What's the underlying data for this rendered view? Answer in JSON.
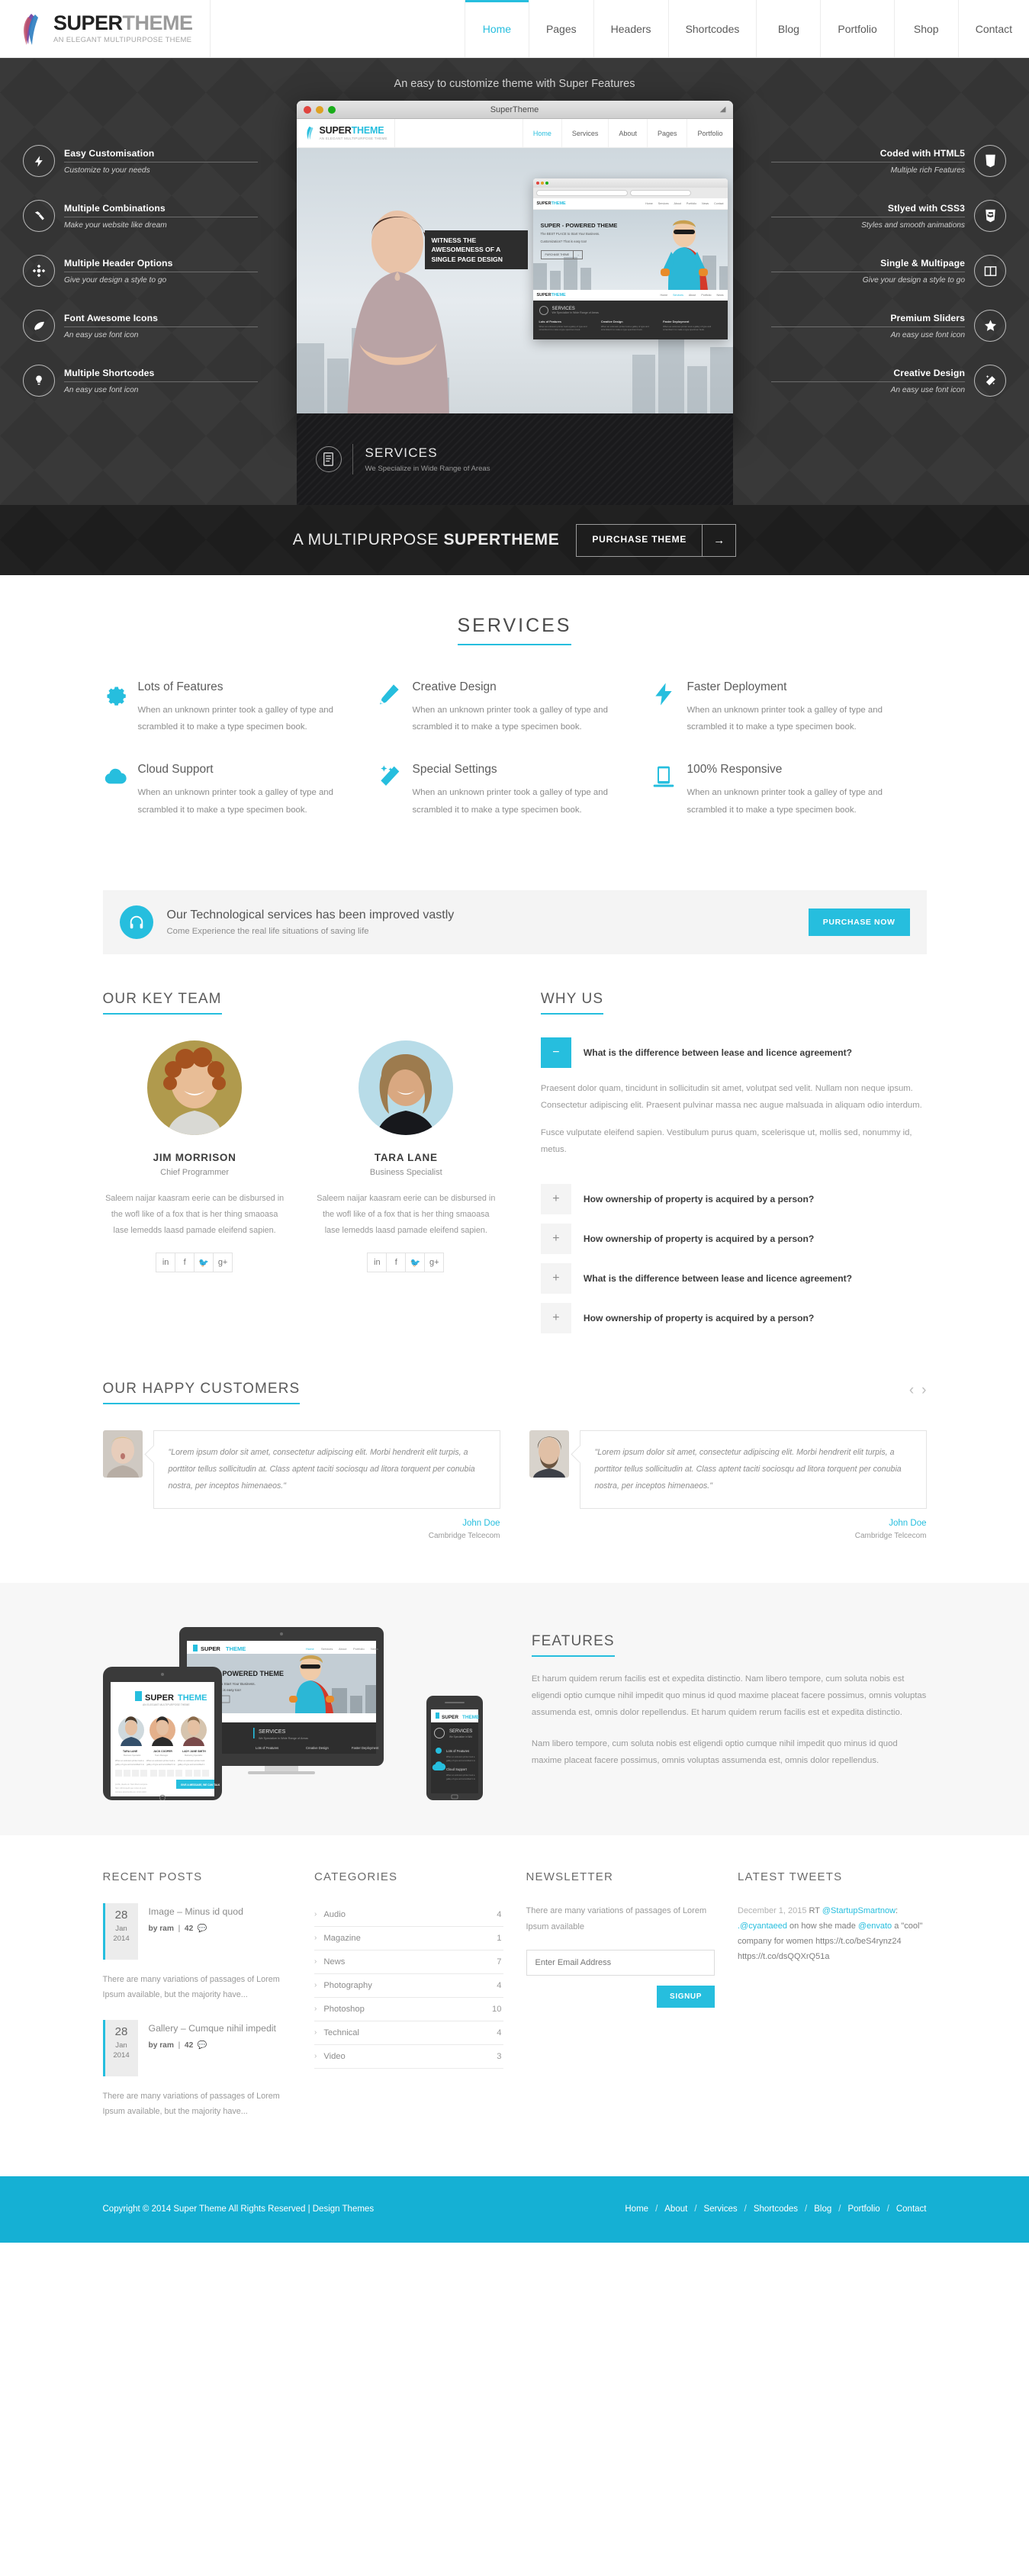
{
  "header": {
    "logo_title_part1": "SUPER",
    "logo_title_part2": "THEME",
    "logo_subtitle": "AN ELEGANT MULTIPURPOSE THEME",
    "nav": [
      {
        "label": "Home",
        "active": true
      },
      {
        "label": "Pages",
        "active": false
      },
      {
        "label": "Headers",
        "active": false
      },
      {
        "label": "Shortcodes",
        "active": false
      },
      {
        "label": "Blog",
        "active": false
      },
      {
        "label": "Portfolio",
        "active": false
      },
      {
        "label": "Shop",
        "active": false
      },
      {
        "label": "Contact",
        "active": false
      }
    ]
  },
  "hero": {
    "tagline": "An easy to customize theme with Super Features",
    "left_features": [
      {
        "title": "Easy Customisation",
        "sub": "Customize to your needs",
        "icon": "bolt-icon"
      },
      {
        "title": "Multiple Combinations",
        "sub": "Make your website like dream",
        "icon": "hammer-icon"
      },
      {
        "title": "Multiple Header Options",
        "sub": "Give your design a style to go",
        "icon": "crosshair-icon"
      },
      {
        "title": "Font Awesome Icons",
        "sub": "An easy use font icon",
        "icon": "leaf-icon"
      },
      {
        "title": "Multiple Shortcodes",
        "sub": "An easy use font icon",
        "icon": "lightbulb-icon"
      }
    ],
    "right_features": [
      {
        "title": "Coded with HTML5",
        "sub": "Multiple rich Features",
        "icon": "html5-icon"
      },
      {
        "title": "Stlyed with CSS3",
        "sub": "Styles and smooth animations",
        "icon": "css3-icon"
      },
      {
        "title": "Single & Multipage",
        "sub": "Give your design a style to go",
        "icon": "columns-icon"
      },
      {
        "title": "Premium Sliders",
        "sub": "An easy use font icon",
        "icon": "star-icon"
      },
      {
        "title": "Creative Design",
        "sub": "An easy use font icon",
        "icon": "magic-wand-icon"
      }
    ],
    "browser": {
      "window_title": "SuperTheme",
      "logo_part1": "SUPER",
      "logo_part2": "THEME",
      "logo_sub": "AN ELEGANT MULTIPURPOSE THEME",
      "nav": [
        "Home",
        "Services",
        "About",
        "Pages",
        "Portfolio"
      ],
      "callout": "WITNESS THE AWESOMENESS OF A SINGLE PAGE DESIGN",
      "inner": {
        "logo_part1": "SUPER",
        "logo_part2": "THEME",
        "nav": [
          "Home",
          "Services",
          "About",
          "Portfolio",
          "News",
          "Contact"
        ],
        "headline": "SUPER - POWERED THEME",
        "sub1": "The BEST PLACE to Start Your Business.",
        "sub2": "Customization? That is easy too!",
        "btn": "PURCHASE THEME",
        "services_title": "SERVICES",
        "services_sub": "We Specialize in Wide Range of Areas",
        "cards": [
          {
            "title": "Lots of Features",
            "text": "When an unknown printer took a galley of type and scrambled it to make a type specimen book."
          },
          {
            "title": "Creative Design",
            "text": "When an unknown printer took a galley of type and scrambled it to make a type specimen book."
          },
          {
            "title": "Faster Deployment",
            "text": "When an unknown printer took a galley of type and scrambled it to make a type specimen book."
          }
        ]
      }
    },
    "services_strip": {
      "title": "SERVICES",
      "subtitle": "We Specialize in Wide Range of Areas"
    },
    "footer_text_normal": "A MULTIPURPOSE ",
    "footer_text_bold": "SUPERTHEME",
    "purchase_button": "PURCHASE THEME",
    "purchase_arrow": "→"
  },
  "services": {
    "title": "SERVICES",
    "items": [
      {
        "title": "Lots of Features",
        "text": "When an unknown printer took a galley of type and scrambled it to make a type specimen book.",
        "icon": "gear-icon"
      },
      {
        "title": "Creative Design",
        "text": "When an unknown printer took a galley of type and scrambled it to make a type specimen book.",
        "icon": "pencil-icon"
      },
      {
        "title": "Faster Deployment",
        "text": "When an unknown printer took a galley of type and scrambled it to make a type specimen book.",
        "icon": "bolt-icon"
      },
      {
        "title": "Cloud Support",
        "text": "When an unknown printer took a galley of type and scrambled it to make a type specimen book.",
        "icon": "cloud-icon"
      },
      {
        "title": "Special Settings",
        "text": "When an unknown printer took a galley of type and scrambled it to make a type specimen book.",
        "icon": "magic-wand-icon"
      },
      {
        "title": "100% Responsive",
        "text": "When an unknown printer took a galley of type and scrambled it to make a type specimen book.",
        "icon": "tablet-icon"
      }
    ]
  },
  "cta": {
    "title": "Our Technological services has been improved vastly",
    "subtitle": "Come Experience the real life situations of saving life",
    "button": "PURCHASE NOW",
    "icon": "headphones-icon"
  },
  "team": {
    "title": "OUR KEY TEAM",
    "members": [
      {
        "name": "JIM MORRISON",
        "role": "Chief Programmer",
        "bio": "Saleem naijar kaasram eerie can be disbursed in the wofl like of a fox that is her thing smaoasa lase lemedds laasd pamade eleifend sapien.",
        "social": [
          "in",
          "f",
          "t",
          "g+"
        ]
      },
      {
        "name": "TARA LANE",
        "role": "Business Specialist",
        "bio": "Saleem naijar kaasram eerie can be disbursed in the wofl like of a fox that is her thing smaoasa lase lemedds laasd pamade eleifend sapien.",
        "social": [
          "in",
          "f",
          "t",
          "g+"
        ]
      }
    ]
  },
  "why_us": {
    "title": "WHY US",
    "items": [
      {
        "question": "What is the difference between lease and licence agreement?",
        "open": true,
        "icon": "minus-icon",
        "paragraphs": [
          "Praesent dolor quam, tincidunt in sollicitudin sit amet, volutpat sed velit. Nullam non neque ipsum. Consectetur adipiscing elit. Praesent pulvinar massa nec augue malsuada in aliquam odio interdum.",
          "Fusce vulputate eleifend sapien. Vestibulum purus quam, scelerisque ut, mollis sed, nonummy id, metus."
        ]
      },
      {
        "question": "How ownership of property is acquired by a person?",
        "open": false,
        "icon": "plus-icon",
        "paragraphs": []
      },
      {
        "question": "How ownership of property is acquired by a person?",
        "open": false,
        "icon": "plus-icon",
        "paragraphs": []
      },
      {
        "question": "What is the difference between lease and licence agreement?",
        "open": false,
        "icon": "plus-icon",
        "paragraphs": []
      },
      {
        "question": "How ownership of property is acquired by a person?",
        "open": false,
        "icon": "plus-icon",
        "paragraphs": []
      }
    ]
  },
  "testimonials": {
    "title": "OUR HAPPY CUSTOMERS",
    "prev_icon": "chevron-left-icon",
    "next_icon": "chevron-right-icon",
    "items": [
      {
        "quote": "\"Lorem ipsum dolor sit amet, consectetur adipiscing elit. Morbi hendrerit elit turpis, a porttitor tellus sollicitudin at. Class aptent taciti sociosqu ad litora torquent per conubia nostra, per inceptos himenaeos.\"",
        "name": "John Doe",
        "company": "Cambridge Telcecom"
      },
      {
        "quote": "\"Lorem ipsum dolor sit amet, consectetur adipiscing elit. Morbi hendrerit elit turpis, a porttitor tellus sollicitudin at. Class aptent taciti sociosqu ad litora torquent per conubia nostra, per inceptos himenaeos.\"",
        "name": "John Doe",
        "company": "Cambridge Telcecom"
      }
    ]
  },
  "features": {
    "title": "FEATURES",
    "paragraphs": [
      "Et harum quidem rerum facilis est et expedita distinctio. Nam libero tempore, cum soluta nobis est eligendi optio cumque nihil impedit quo minus id quod maxime placeat facere possimus, omnis voluptas assumenda est, omnis dolor repellendus. Et harum quidem rerum facilis est et expedita distinctio.",
      "Nam libero tempore, cum soluta nobis est eligendi optio cumque nihil impedit quo minus id quod maxime placeat facere possimus, omnis voluptas assumenda est, omnis dolor repellendus."
    ],
    "device_logo_part1": "SUPER",
    "device_logo_part2": "THEME",
    "device_headline": "PER - POWERED THEME",
    "device_services": "SERVICES",
    "device_services_sub": "We Specialize in Wide Range of Areas"
  },
  "widgets": {
    "recent_posts": {
      "title": "RECENT POSTS",
      "posts": [
        {
          "day": "28",
          "month": "Jan",
          "year": "2014",
          "title": "Image – Minus id quod",
          "author_prefix": "by ram",
          "comments": "42",
          "excerpt": "There are many variations of passages of Lorem Ipsum available, but the majority have..."
        },
        {
          "day": "28",
          "month": "Jan",
          "year": "2014",
          "title": "Gallery – Cumque nihil impedit",
          "author_prefix": "by ram",
          "comments": "42",
          "excerpt": "There are many variations of passages of Lorem Ipsum available, but the majority have..."
        }
      ]
    },
    "categories": {
      "title": "CATEGORIES",
      "items": [
        {
          "name": "Audio",
          "count": "4"
        },
        {
          "name": "Magazine",
          "count": "1"
        },
        {
          "name": "News",
          "count": "7"
        },
        {
          "name": "Photography",
          "count": "4"
        },
        {
          "name": "Photoshop",
          "count": "10"
        },
        {
          "name": "Technical",
          "count": "4"
        },
        {
          "name": "Video",
          "count": "3"
        }
      ]
    },
    "newsletter": {
      "title": "NEWSLETTER",
      "text": "There are many variations of passages of Lorem Ipsum available",
      "placeholder": "Enter Email Address",
      "button": "SIGNUP"
    },
    "tweets": {
      "title": "LATEST TWEETS",
      "date": "December 1, 2015",
      "rt": " RT ",
      "handle1": "@StartupSmartnow",
      "colon": ": ",
      "handle2": ".@cyantaeed",
      "mid": " on how she made ",
      "handle3": "@envato",
      "tail": " a \"cool\" company for women ",
      "link1": "https://t.co/beS4rynz24",
      "link2": "https://t.co/dsQQXrQ51a"
    }
  },
  "footer": {
    "copyright": "Copyright © 2014 Super Theme All Rights Reserved | Design Themes",
    "nav": [
      "Home",
      "About",
      "Services",
      "Shortcodes",
      "Blog",
      "Portfolio",
      "Contact"
    ],
    "separator": "/"
  },
  "colors": {
    "accent": "#26bede",
    "footer_bg": "#15b0d4",
    "hero_bg": "#343434"
  }
}
